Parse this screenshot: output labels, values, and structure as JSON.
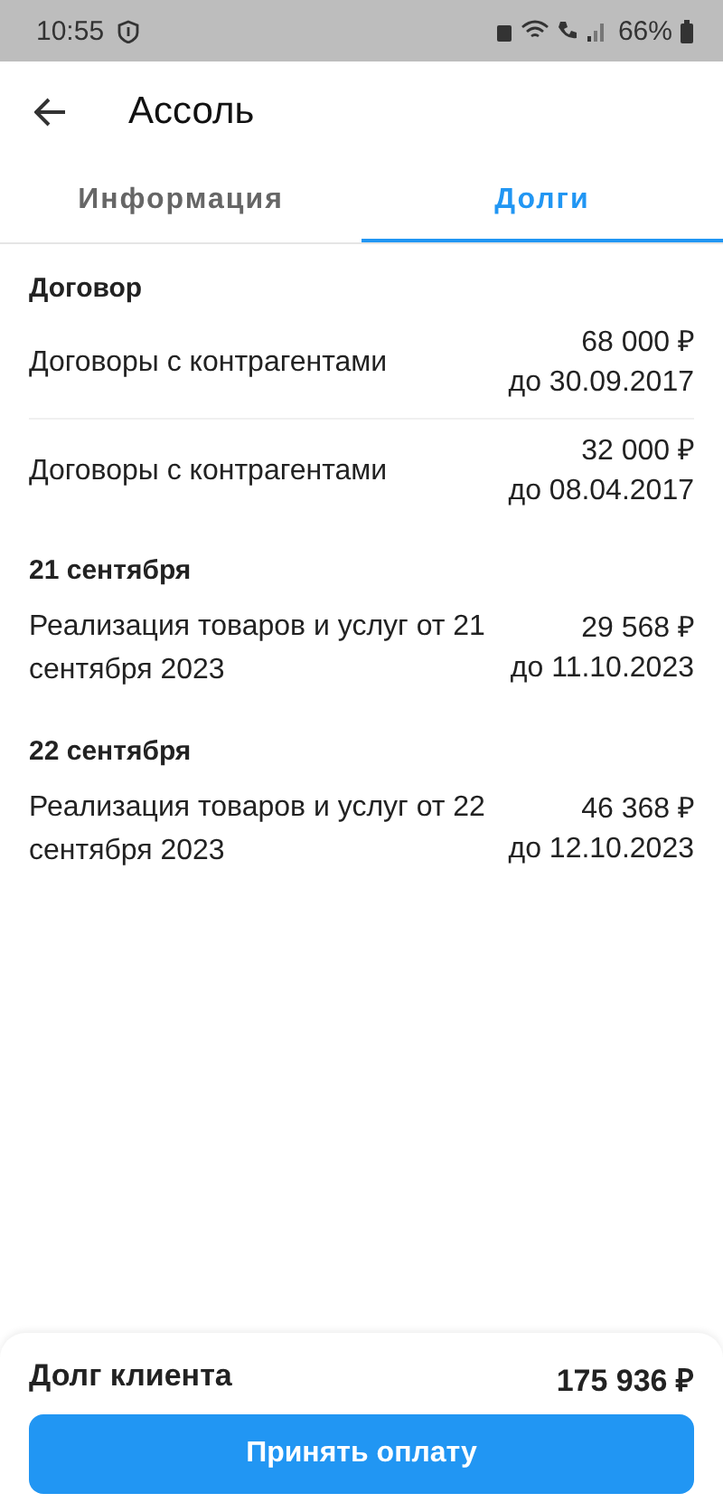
{
  "status_bar": {
    "time": "10:55",
    "battery": "66%"
  },
  "header": {
    "title": "Ассоль"
  },
  "tabs": [
    {
      "label": "Информация",
      "selected": false
    },
    {
      "label": "Долги",
      "selected": true
    }
  ],
  "groups": [
    {
      "title": "Договор",
      "rows": [
        {
          "name": "Договоры с контрагентами",
          "amount": "68 000 ₽",
          "due": "до 30.09.2017"
        },
        {
          "name": "Договоры с контрагентами",
          "amount": "32 000 ₽",
          "due": "до 08.04.2017"
        }
      ]
    },
    {
      "title": "21 сентября",
      "rows": [
        {
          "name": "Реализация товаров и услуг от 21 сентября 2023",
          "amount": "29 568 ₽",
          "due": "до 11.10.2023"
        }
      ]
    },
    {
      "title": "22 сентября",
      "rows": [
        {
          "name": "Реализация товаров и услуг от 22 сентября 2023",
          "amount": "46 368 ₽",
          "due": "до 12.10.2023"
        }
      ]
    }
  ],
  "footer": {
    "label": "Долг клиента",
    "total": "175 936 ₽",
    "button": "Принять оплату"
  }
}
